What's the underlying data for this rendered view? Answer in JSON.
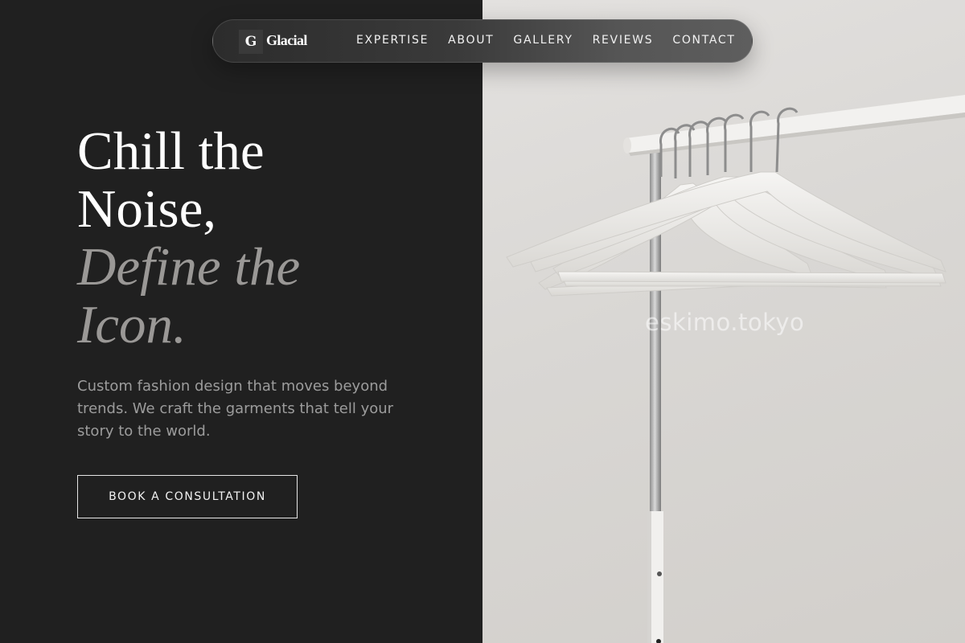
{
  "brand": {
    "logo_mark": "G",
    "name": "Glacial"
  },
  "nav": {
    "links": [
      "EXPERTISE",
      "ABOUT",
      "GALLERY",
      "REVIEWS",
      "CONTACT"
    ]
  },
  "hero": {
    "title_lines": [
      "Chill the",
      "Noise,",
      "Define the",
      "Icon."
    ],
    "description": "Custom fashion design that moves beyond trends. We craft the garments that tell your story to the world.",
    "cta_label": "BOOK A CONSULTATION"
  },
  "image": {
    "subject": "clothing-rack-with-white-hangers",
    "watermark": "eskimo.tokyo"
  },
  "colors": {
    "background_dark": "#202020",
    "text_primary": "#ffffff",
    "text_accent": "#9a9896",
    "text_muted": "#9c9c9c"
  }
}
